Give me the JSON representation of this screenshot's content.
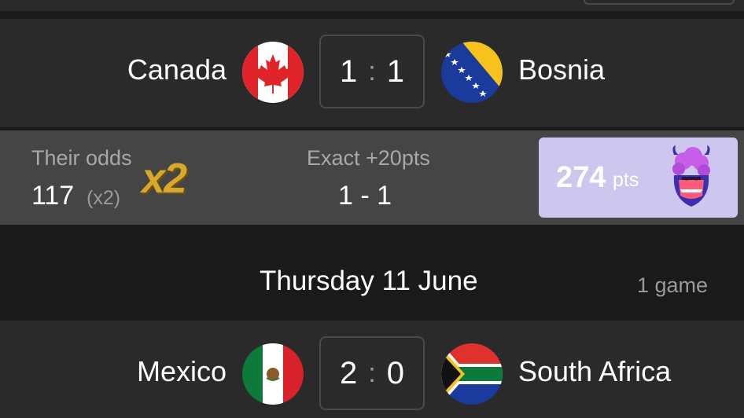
{
  "matches": [
    {
      "home": "Canada",
      "away": "Bosnia",
      "home_score": "1",
      "away_score": "1",
      "separator": ":"
    },
    {
      "home": "Mexico",
      "away": "South Africa",
      "home_score": "2",
      "away_score": "0",
      "separator": ":"
    }
  ],
  "prediction": {
    "odds_label": "Their odds",
    "odds_value": "117",
    "odds_multiplier": "(x2)",
    "boost_badge": "x2",
    "exact_label": "Exact +20pts",
    "exact_value": "1 - 1",
    "points_value": "274",
    "points_unit": "pts"
  },
  "day_header": {
    "title": "Thursday 11 June",
    "count": "1 game"
  },
  "colors": {
    "background": "#1a1a1a",
    "card": "#2a2a2a",
    "odds_bar": "#454545",
    "points_card": "#cdc6ef",
    "boost": "#d9a82a"
  }
}
